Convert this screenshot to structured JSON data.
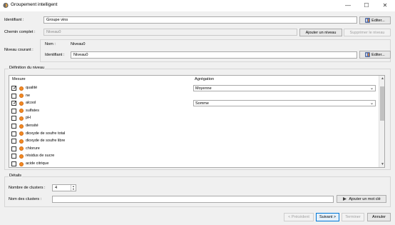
{
  "window": {
    "title": "Groupement intelligent",
    "minimize": "—",
    "maximize": "☐",
    "close": "✕"
  },
  "identifiant": {
    "label": "Identifiant :",
    "value": "Groupe vins",
    "edit_label": "Editer..."
  },
  "chemin": {
    "label": "Chemin complet :",
    "value": "Niveau0",
    "add_label": "Ajouter un niveau",
    "remove_label": "Supprimer le niveau"
  },
  "niveau": {
    "label": "Niveau courant :",
    "nom_label": "Nom :",
    "nom_value": "Niveau0",
    "id_label": "Identifiant :",
    "id_value": "Niveau0",
    "edit_label": "Editer..."
  },
  "definition": {
    "title": "Définition du niveau",
    "col_mesure": "Mesure",
    "col_agregation": "Agrégation",
    "rows": [
      {
        "name": "qualité",
        "checked": true,
        "aggregation": "Moyenne"
      },
      {
        "name": "ne",
        "checked": false,
        "aggregation": ""
      },
      {
        "name": "alcool",
        "checked": true,
        "aggregation": "Somme"
      },
      {
        "name": "sulfates",
        "checked": false,
        "aggregation": ""
      },
      {
        "name": "pH",
        "checked": false,
        "aggregation": ""
      },
      {
        "name": "densité",
        "checked": false,
        "aggregation": ""
      },
      {
        "name": "dioxyde de soufre total",
        "checked": false,
        "aggregation": ""
      },
      {
        "name": "dioxyde de soufre libre",
        "checked": false,
        "aggregation": ""
      },
      {
        "name": "chlorure",
        "checked": false,
        "aggregation": ""
      },
      {
        "name": "résidus de sucre",
        "checked": false,
        "aggregation": ""
      },
      {
        "name": "acide citrique",
        "checked": false,
        "aggregation": ""
      }
    ]
  },
  "details": {
    "title": "Détails",
    "clusters_label": "Nombre de clusters :",
    "clusters_value": "4",
    "names_label": "Nom des clusters :",
    "names_value": "",
    "add_keyword_label": "Ajouter un mot clé"
  },
  "footer": {
    "prev": "< Précédent",
    "next": "Suivant >",
    "finish": "Terminer",
    "cancel": "Annuler"
  },
  "colors": {
    "measure_dot": "#f28a24",
    "accent": "#0078d7"
  }
}
